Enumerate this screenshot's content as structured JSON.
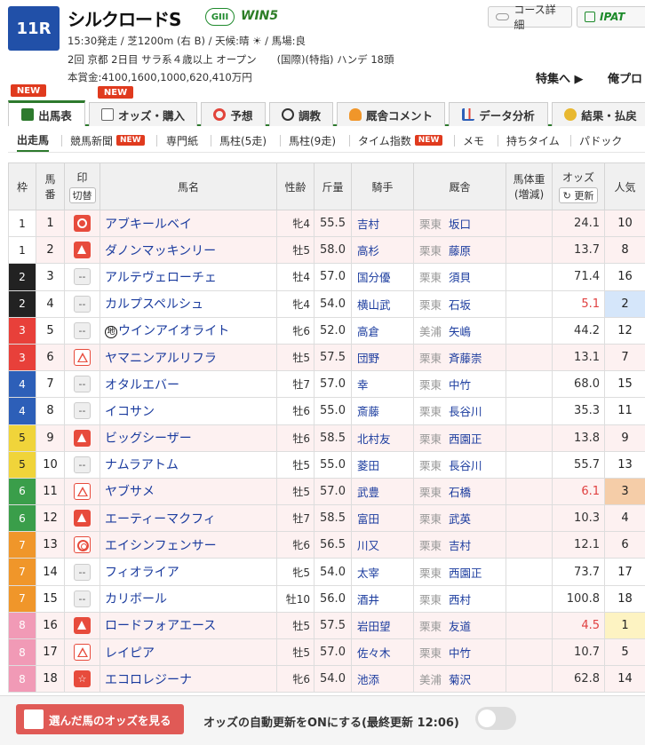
{
  "race": {
    "number": "11R",
    "name": "シルクロードS",
    "grade": "GIII",
    "win5": "WIN5",
    "line1": "15:30発走 / 芝1200m (右 B) / 天候:晴 ☀ / 馬場:良",
    "line2": "2回 京都 2日目 サラ系４歳以上 オープン　　(国際)(特指) ハンデ 18頭",
    "line3": "本賞金:4100,1600,1000,620,410万円"
  },
  "header_buttons": {
    "course": "コース詳細",
    "ipat": "IPAT"
  },
  "links": {
    "tokushu": "特集へ ▶",
    "ore": "俺プロ"
  },
  "tabs": [
    {
      "label": "出馬表",
      "new": "NEW",
      "icon": "table-icon"
    },
    {
      "label": "オッズ・購入",
      "new": "NEW",
      "icon": "odds-icon"
    },
    {
      "label": "予想",
      "icon": "target-icon"
    },
    {
      "label": "調教",
      "icon": "stopwatch-icon"
    },
    {
      "label": "厩舎コメント",
      "icon": "person-icon"
    },
    {
      "label": "データ分析",
      "icon": "bar-chart-icon"
    },
    {
      "label": "結果・払戻",
      "icon": "coins-icon"
    }
  ],
  "subnav": [
    {
      "label": "出走馬"
    },
    {
      "label": "競馬新聞",
      "new": "NEW"
    },
    {
      "label": "専門紙"
    },
    {
      "label": "馬柱(5走)"
    },
    {
      "label": "馬柱(9走)"
    },
    {
      "label": "タイム指数",
      "new": "NEW"
    },
    {
      "label": "メモ"
    },
    {
      "label": "持ちタイム"
    },
    {
      "label": "パドック"
    }
  ],
  "columns": {
    "waku": "枠",
    "umaban1": "馬",
    "umaban2": "番",
    "mark1": "印",
    "mark2": "切替",
    "name": "馬名",
    "sexage": "性齢",
    "kinryo": "斤量",
    "jockey": "騎手",
    "trainer": "厩舎",
    "weight1": "馬体重",
    "weight2": "(増減)",
    "odds": "オッズ",
    "update": "更新",
    "ninki": "人気"
  },
  "waku_colors": {
    "1": "#ffffff",
    "2": "#222222",
    "3": "#e8403a",
    "4": "#2d5fb8",
    "5": "#f0d43a",
    "6": "#3a9e4a",
    "7": "#f0962a",
    "8": "#f19ab6"
  },
  "entries": [
    {
      "waku": "1",
      "umaban": "1",
      "mark": "◯",
      "markType": "circle",
      "name": "アブキールベイ",
      "sexage": "牝4",
      "kinryo": "55.5",
      "jockey": "吉村",
      "zone": "栗東",
      "trainer": "坂口",
      "odds": "24.1",
      "ninki": "10"
    },
    {
      "waku": "1",
      "umaban": "2",
      "mark": "▲",
      "markType": "triangle",
      "name": "ダノンマッキンリー",
      "sexage": "牡5",
      "kinryo": "58.0",
      "jockey": "高杉",
      "zone": "栗東",
      "trainer": "藤原",
      "odds": "13.7",
      "ninki": "8"
    },
    {
      "waku": "2",
      "umaban": "3",
      "mark": "--",
      "markType": "none",
      "name": "アルテヴェローチェ",
      "sexage": "牡4",
      "kinryo": "57.0",
      "jockey": "国分優",
      "zone": "栗東",
      "trainer": "須貝",
      "odds": "71.4",
      "ninki": "16"
    },
    {
      "waku": "2",
      "umaban": "4",
      "mark": "--",
      "markType": "none",
      "name": "カルプスペルシュ",
      "sexage": "牝4",
      "kinryo": "54.0",
      "jockey": "横山武",
      "zone": "栗東",
      "trainer": "石坂",
      "odds": "5.1",
      "ninki": "2",
      "hot": true,
      "rank": 2
    },
    {
      "waku": "3",
      "umaban": "5",
      "mark": "--",
      "markType": "none",
      "name": "ウインアイオライト",
      "chi": "地",
      "sexage": "牝6",
      "kinryo": "52.0",
      "jockey": "高倉",
      "zone": "美浦",
      "trainer": "矢嶋",
      "odds": "44.2",
      "ninki": "12"
    },
    {
      "waku": "3",
      "umaban": "6",
      "mark": "△",
      "markType": "outline",
      "name": "ヤマニンアルリフラ",
      "sexage": "牡5",
      "kinryo": "57.5",
      "jockey": "団野",
      "zone": "栗東",
      "trainer": "斉藤崇",
      "odds": "13.1",
      "ninki": "7"
    },
    {
      "waku": "4",
      "umaban": "7",
      "mark": "--",
      "markType": "none",
      "name": "オタルエバー",
      "sexage": "牡7",
      "kinryo": "57.0",
      "jockey": "幸",
      "zone": "栗東",
      "trainer": "中竹",
      "odds": "68.0",
      "ninki": "15"
    },
    {
      "waku": "4",
      "umaban": "8",
      "mark": "--",
      "markType": "none",
      "name": "イコサン",
      "sexage": "牡6",
      "kinryo": "55.0",
      "jockey": "斎藤",
      "zone": "栗東",
      "trainer": "長谷川",
      "odds": "35.3",
      "ninki": "11"
    },
    {
      "waku": "5",
      "umaban": "9",
      "mark": "▲",
      "markType": "triangle",
      "name": "ビッグシーザー",
      "sexage": "牡6",
      "kinryo": "58.5",
      "jockey": "北村友",
      "zone": "栗東",
      "trainer": "西園正",
      "odds": "13.8",
      "ninki": "9"
    },
    {
      "waku": "5",
      "umaban": "10",
      "mark": "--",
      "markType": "none",
      "name": "ナムラアトム",
      "sexage": "牡5",
      "kinryo": "55.0",
      "jockey": "菱田",
      "zone": "栗東",
      "trainer": "長谷川",
      "odds": "55.7",
      "ninki": "13"
    },
    {
      "waku": "6",
      "umaban": "11",
      "mark": "△",
      "markType": "outline",
      "name": "ヤブサメ",
      "sexage": "牡5",
      "kinryo": "57.0",
      "jockey": "武豊",
      "zone": "栗東",
      "trainer": "石橋",
      "odds": "6.1",
      "ninki": "3",
      "hot": true,
      "rank": 3
    },
    {
      "waku": "6",
      "umaban": "12",
      "mark": "▲",
      "markType": "triangle",
      "name": "エーティーマクフィ",
      "sexage": "牡7",
      "kinryo": "58.5",
      "jockey": "富田",
      "zone": "栗東",
      "trainer": "武英",
      "odds": "10.3",
      "ninki": "4"
    },
    {
      "waku": "7",
      "umaban": "13",
      "mark": "◎",
      "markType": "double",
      "name": "エイシンフェンサー",
      "sexage": "牝6",
      "kinryo": "56.5",
      "jockey": "川又",
      "zone": "栗東",
      "trainer": "吉村",
      "odds": "12.1",
      "ninki": "6"
    },
    {
      "waku": "7",
      "umaban": "14",
      "mark": "--",
      "markType": "none",
      "name": "フィオライア",
      "sexage": "牝5",
      "kinryo": "54.0",
      "jockey": "太宰",
      "zone": "栗東",
      "trainer": "西園正",
      "odds": "73.7",
      "ninki": "17"
    },
    {
      "waku": "7",
      "umaban": "15",
      "mark": "--",
      "markType": "none",
      "name": "カリボール",
      "sexage": "牡10",
      "kinryo": "56.0",
      "jockey": "酒井",
      "zone": "栗東",
      "trainer": "西村",
      "odds": "100.8",
      "ninki": "18"
    },
    {
      "waku": "8",
      "umaban": "16",
      "mark": "▲",
      "markType": "triangle",
      "name": "ロードフォアエース",
      "sexage": "牡5",
      "kinryo": "57.5",
      "jockey": "岩田望",
      "zone": "栗東",
      "trainer": "友道",
      "odds": "4.5",
      "ninki": "1",
      "hot": true,
      "rank": 1
    },
    {
      "waku": "8",
      "umaban": "17",
      "mark": "△",
      "markType": "outline",
      "name": "レイピア",
      "sexage": "牡5",
      "kinryo": "57.0",
      "jockey": "佐々木",
      "zone": "栗東",
      "trainer": "中竹",
      "odds": "10.7",
      "ninki": "5"
    },
    {
      "waku": "8",
      "umaban": "18",
      "mark": "☆",
      "markType": "star",
      "name": "エコロレジーナ",
      "sexage": "牝6",
      "kinryo": "54.0",
      "jockey": "池添",
      "zone": "美浦",
      "trainer": "菊沢",
      "odds": "62.8",
      "ninki": "14"
    }
  ],
  "rank_colors": {
    "1": "#fdf3c2",
    "2": "#d5e6fa",
    "3": "#f5cda8"
  },
  "bottom": {
    "odds_button": "選んだ馬のオッズを見る",
    "auto_update": "オッズの自動更新をONにする(最終更新 12:06)"
  }
}
